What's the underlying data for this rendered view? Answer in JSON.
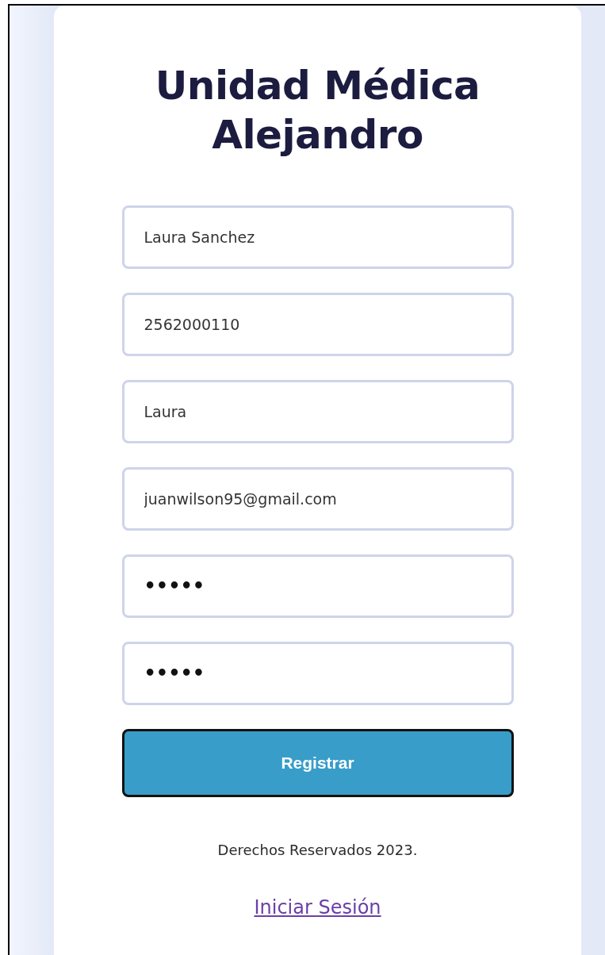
{
  "title": "Unidad Médica Alejandro",
  "fields": [
    {
      "kind": "text",
      "value": "Laura Sanchez"
    },
    {
      "kind": "text",
      "value": "2562000110"
    },
    {
      "kind": "text",
      "value": "Laura"
    },
    {
      "kind": "text",
      "value": "juanwilson95@gmail.com"
    },
    {
      "kind": "password",
      "value": "•••••"
    },
    {
      "kind": "password",
      "value": "•••••"
    }
  ],
  "submit_button": "Registrar",
  "footer": "Derechos Reservados 2023.",
  "login_link": "Iniciar Sesión"
}
